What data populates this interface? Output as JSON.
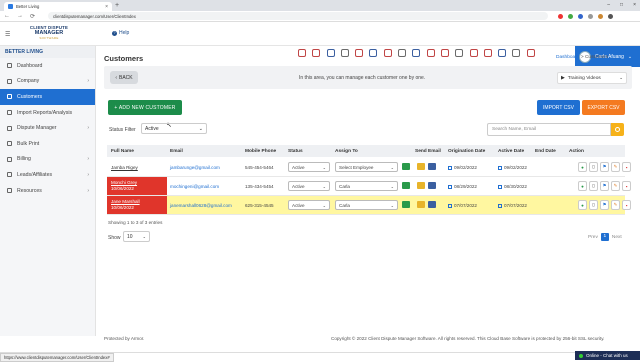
{
  "browser": {
    "tab_title": "Better Living",
    "tab_close": "×",
    "new_tab": "+",
    "url": "clientdisputemanager.com/User/ClientIndex",
    "window_controls": [
      "–",
      "□",
      "×"
    ]
  },
  "header": {
    "logo_line1": "CLIENT DISPUTE",
    "logo_line2": "MANAGER",
    "logo_line3": "SOFTWARE",
    "help_label": "Help",
    "user_name": "Carla Afuang",
    "user_chevron": "⌄"
  },
  "sidebar": {
    "brand": "BETTER LIVING",
    "items": [
      {
        "label": "Dashboard",
        "chevron": ""
      },
      {
        "label": "Company",
        "chevron": "›"
      },
      {
        "label": "Customers",
        "chevron": ""
      },
      {
        "label": "Import Reports/Analysis",
        "chevron": ""
      },
      {
        "label": "Dispute Manager",
        "chevron": "›"
      },
      {
        "label": "Bulk Print",
        "chevron": ""
      },
      {
        "label": "Billing",
        "chevron": "›"
      },
      {
        "label": "Leads/Affiliates",
        "chevron": "›"
      },
      {
        "label": "Resources",
        "chevron": "›"
      }
    ],
    "active_index": 2
  },
  "page": {
    "title": "Customers",
    "breadcrumb_home": "Dashboard",
    "breadcrumb_sep": ">",
    "breadcrumb_current": "Customers",
    "back_label": "BACK",
    "info_text": "In this area, you can manage each customer one by one.",
    "training_label": "Training Videos",
    "training_chevron": "⌄"
  },
  "actions": {
    "add_label": "+ ADD NEW CUSTOMER",
    "import_label": "IMPORT CSV",
    "export_label": "EXPORT CSV"
  },
  "filter": {
    "label": "Status Filter",
    "value": "Active",
    "chevron": "⌄",
    "search_placeholder": "Search Name, Email"
  },
  "table": {
    "headers": [
      "Full Name",
      "Email",
      "Mobile Phone",
      "Status",
      "Assign To",
      "Send Email",
      "Origination Date",
      "Active Date",
      "End Date",
      "Action"
    ],
    "rows": [
      {
        "name": "Jamba Rigey",
        "date": "",
        "email": "jambarunge@gmail.com",
        "phone": "545-454-5464",
        "status": "Active",
        "assign": "Select Employee",
        "orig": "09/02/2022",
        "active": "09/02/2022",
        "end": "",
        "style": "plain"
      },
      {
        "name": "Monchi Grey",
        "date": "10/06/2022",
        "email": "mochingeni@gmail.com",
        "phone": "135-434-5454",
        "status": "Active",
        "assign": "Carla",
        "orig": "08/29/2022",
        "active": "08/30/2022",
        "end": "",
        "style": "red"
      },
      {
        "name": "Jane Marshall",
        "date": "10/06/2022",
        "email": "janemarshall0628@gmail.com",
        "phone": "625-315-4545",
        "status": "Active",
        "assign": "Carla",
        "orig": "07/07/2022",
        "active": "07/07/2022",
        "end": "",
        "style": "red-yellow"
      }
    ],
    "select_chevron": "⌄"
  },
  "pagination": {
    "showing": "Showing 1 to 3 of 3 entries",
    "show_label": "Show",
    "show_value": "10",
    "prev": "Prev",
    "page": "1",
    "next": "Next"
  },
  "footer": {
    "left": "Protected by Armor.",
    "right": "Copyright © 2022 Client Dispute Manager Software. All rights reserved. This Cloud Base Software is protected by 256-bit SSL security."
  },
  "status_bar": {
    "url": "https://www.clientdisputemanager.com/User/ClientIndex#",
    "chat": "Online - Chat with us"
  },
  "colors": {
    "primary": "#1f6fd1",
    "add_green": "#1c8c4a",
    "export_orange": "#f47a20",
    "red_flag": "#e0352b",
    "highlight_yellow": "#fff7a0"
  }
}
